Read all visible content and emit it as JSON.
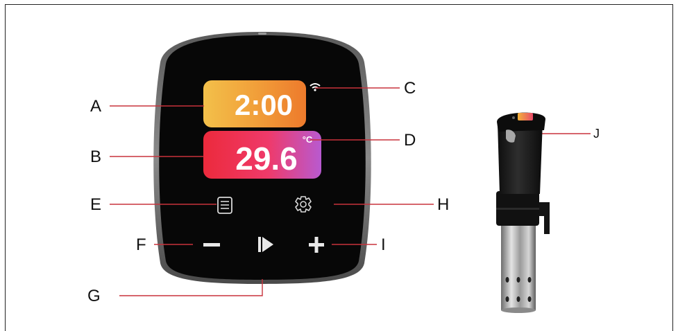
{
  "display": {
    "time": "2:00",
    "temperature": "29.6",
    "unit": "°C"
  },
  "callouts": {
    "A": "A",
    "B": "B",
    "C": "C",
    "D": "D",
    "E": "E",
    "F": "F",
    "G": "G",
    "H": "H",
    "I": "I",
    "J": "J"
  },
  "colors": {
    "time_gradient": [
      "#f2c24a",
      "#f0a236",
      "#ee7d2c"
    ],
    "temp_gradient": [
      "#ee2d44",
      "#ef3d6a",
      "#c04fc4"
    ],
    "leader_line": "#c8323c",
    "device_body": "#1b1b1b"
  },
  "icons": {
    "menu": "menu-list-icon",
    "settings": "gear-icon",
    "minus": "minus-icon",
    "play": "play-icon",
    "plus": "plus-icon",
    "wifi": "wifi-icon"
  }
}
